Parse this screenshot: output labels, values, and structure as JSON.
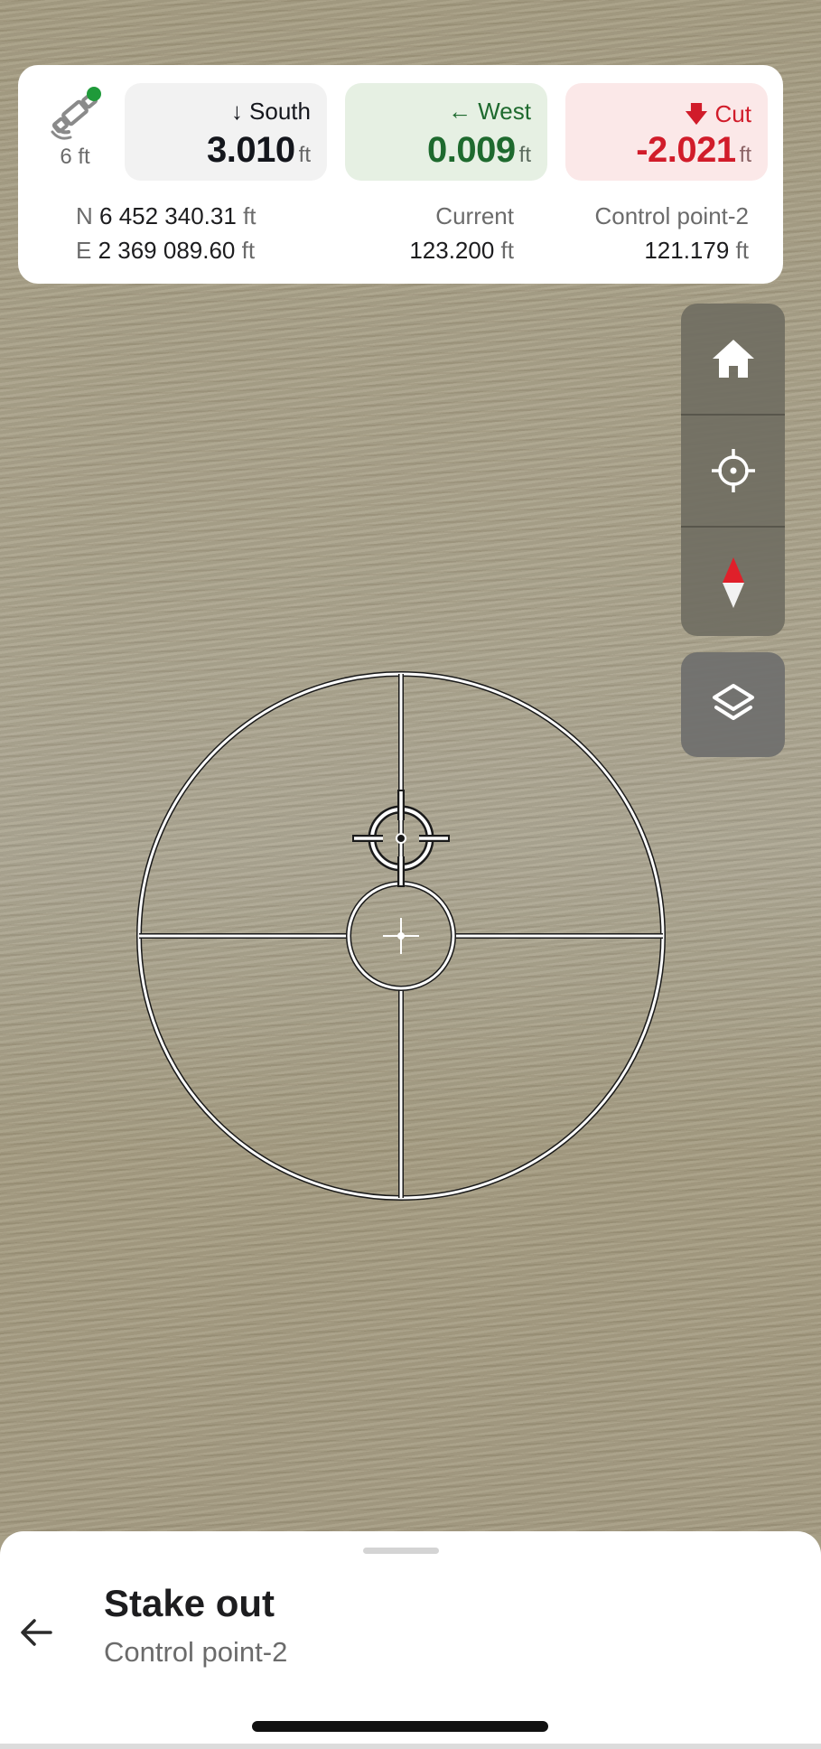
{
  "gps": {
    "accuracy_label": "6 ft",
    "status_color": "#1f9a3a"
  },
  "tiles": {
    "south": {
      "direction": "South",
      "arrow": "↓",
      "value": "3.010",
      "unit": "ft"
    },
    "west": {
      "direction": "West",
      "arrow": "←",
      "value": "0.009",
      "unit": "ft"
    },
    "cut": {
      "direction": "Cut",
      "arrow": "🡇",
      "value": "-2.021",
      "unit": "ft"
    }
  },
  "coords": {
    "n_prefix": "N",
    "n_value": "6 452 340.31",
    "n_unit": "ft",
    "e_prefix": "E",
    "e_value": "2 369 089.60",
    "e_unit": "ft"
  },
  "elevation": {
    "current_label": "Current",
    "current_value": "123.200",
    "current_unit": "ft",
    "target_label": "Control point-2",
    "target_value": "121.179",
    "target_unit": "ft"
  },
  "controls": [
    "home-icon",
    "crosshair-icon",
    "compass-icon",
    "layers-icon"
  ],
  "sheet": {
    "title": "Stake out",
    "subtitle": "Control point-2"
  },
  "colors": {
    "west_green": "#1e6a2e",
    "cut_red": "#d11c2a",
    "compass_red": "#e0202a"
  }
}
